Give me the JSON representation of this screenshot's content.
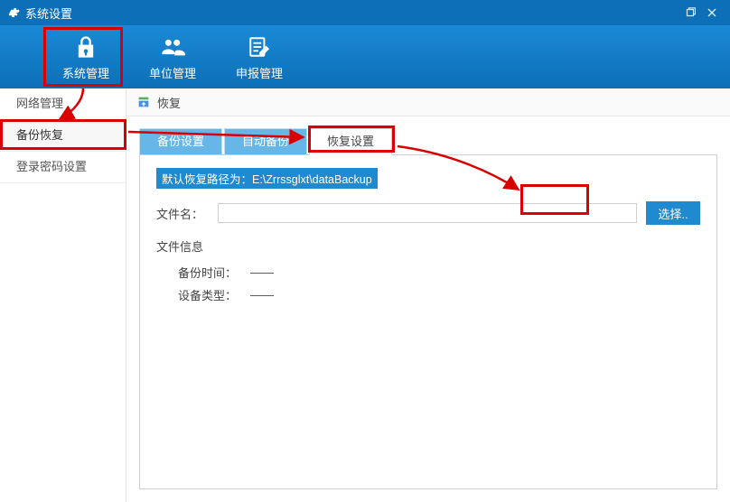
{
  "titlebar": {
    "title": "系统设置"
  },
  "toolbar": {
    "items": [
      {
        "label": "系统管理"
      },
      {
        "label": "单位管理"
      },
      {
        "label": "申报管理"
      }
    ]
  },
  "sidebar": {
    "items": [
      {
        "label": "网络管理"
      },
      {
        "label": "备份恢复"
      },
      {
        "label": "登录密码设置"
      }
    ]
  },
  "page": {
    "header": "恢复",
    "tabs": [
      {
        "label": "备份设置"
      },
      {
        "label": "自动备份"
      },
      {
        "label": "恢复设置"
      }
    ],
    "default_path_text": "默认恢复路径为：E:\\Zrrssglxt\\dataBackup",
    "filename_label": "文件名：",
    "filename_value": "",
    "choose_button": "选择..",
    "fileinfo_title": "文件信息",
    "fileinfo": {
      "backup_time_label": "备份时间：",
      "backup_time_value": "——",
      "device_type_label": "设备类型：",
      "device_type_value": "——"
    }
  }
}
